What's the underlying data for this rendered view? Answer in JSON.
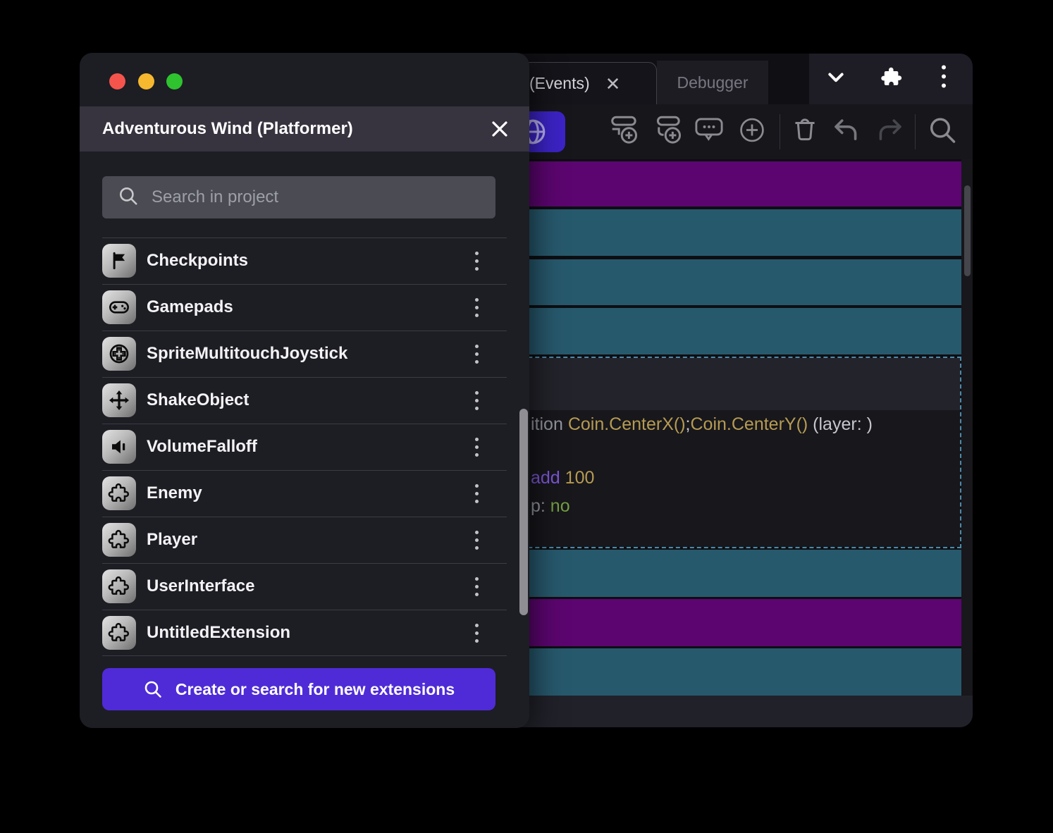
{
  "modal": {
    "title": "Adventurous Wind (Platformer)",
    "search": {
      "placeholder": "Search in project"
    },
    "items": [
      {
        "name": "Checkpoints",
        "icon": "flag-icon"
      },
      {
        "name": "Gamepads",
        "icon": "gamepad-icon"
      },
      {
        "name": "SpriteMultitouchJoystick",
        "icon": "joystick-icon"
      },
      {
        "name": "ShakeObject",
        "icon": "move-arrows-icon"
      },
      {
        "name": "VolumeFalloff",
        "icon": "speaker-icon"
      },
      {
        "name": "Enemy",
        "icon": "puzzle-icon"
      },
      {
        "name": "Player",
        "icon": "puzzle-icon"
      },
      {
        "name": "UserInterface",
        "icon": "puzzle-icon"
      },
      {
        "name": "UntitledExtension",
        "icon": "puzzle-icon"
      }
    ],
    "create_button": {
      "label": "Create or search for new extensions"
    }
  },
  "editor": {
    "tabs": [
      {
        "label": "(Events)",
        "active": true,
        "closable": true
      },
      {
        "label": "Debugger",
        "active": false
      }
    ],
    "event_rows": [
      "purple",
      "teal",
      "teal",
      "teal",
      "selected",
      "teal",
      "purple",
      "teal"
    ],
    "selected_event": {
      "lines": [
        {
          "segments": [
            {
              "text": "ition ",
              "color": "gray"
            },
            {
              "text": "Coin.CenterX()",
              "color": "gold"
            },
            {
              "text": ";",
              "color": "lightgray"
            },
            {
              "text": "Coin.CenterY()",
              "color": "gold"
            },
            {
              "text": " (layer: )",
              "color": "lightgray"
            }
          ]
        },
        {
          "segments": [
            {
              "text": "add ",
              "color": "purple"
            },
            {
              "text": "100",
              "color": "gold"
            }
          ]
        },
        {
          "segments": [
            {
              "text": "p: ",
              "color": "gray"
            },
            {
              "text": "no",
              "color": "green"
            }
          ]
        }
      ]
    },
    "colors": {
      "event_teal": "#27596d",
      "event_purple": "#5c0570",
      "selection_border": "#4d89a8",
      "accent_button": "#4f2bd7",
      "toolbar_active_button": "#3c23c6"
    }
  }
}
